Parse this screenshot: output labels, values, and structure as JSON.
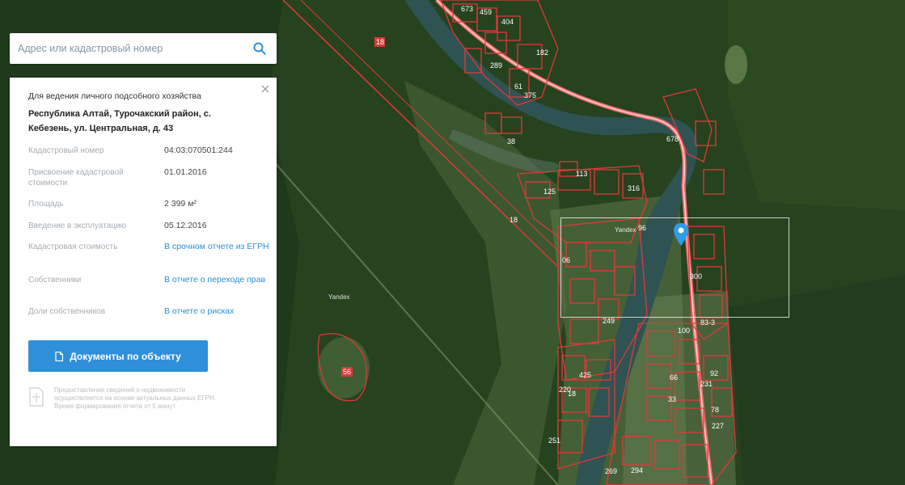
{
  "search": {
    "placeholder": "Адрес или кадастровый номер"
  },
  "card": {
    "purpose": "Для ведения личного подсобного хозяйства",
    "address": "Республика Алтай, Турочакский район, с. Кебезень, ул. Центральная, д. 43",
    "rows": [
      {
        "label": "Кадастровый номер",
        "value": "04:03:070501:244"
      },
      {
        "label": "Присвоение кадастровой стоимости",
        "value": "01.01.2016"
      },
      {
        "label": "Площадь",
        "value": "2 399 м²"
      },
      {
        "label": "Введение в эксплуатацию",
        "value": "05.12.2016"
      },
      {
        "label": "Кадастровая стоимость",
        "value": "В срочном отчете из ЕГРН"
      },
      {
        "label": "Собственники",
        "value": "В отчете о переходе прав"
      },
      {
        "label": "Доли собственников",
        "value": "В отчете о рисках"
      }
    ],
    "docs_button": "Документы по объекту",
    "note": "Предоставление сведений о недвижимости осуществляется на основе актуальных данных ЕГРН. Время формирования отчета от 5 минут"
  },
  "map": {
    "attribution": [
      "Yandex",
      "Yandex"
    ],
    "parcel_labels": [
      "673",
      "459",
      "404",
      "18",
      "289",
      "182",
      "61",
      "375",
      "678",
      "38",
      "113",
      "125",
      "18",
      "316",
      "06",
      "96",
      "300",
      "249",
      "83-3",
      "100",
      "425",
      "56",
      "220",
      "18",
      "231",
      "66",
      "92",
      "33",
      "78",
      "251",
      "227",
      "269",
      "294"
    ]
  },
  "colors": {
    "accent": "#2f8fd8",
    "parcel_outline": "#e0393a",
    "river": "#2f5252",
    "forest": "#24411f"
  },
  "icons": [
    "search-icon",
    "close-icon",
    "document-icon",
    "map-pin-icon",
    "info-document-icon"
  ]
}
